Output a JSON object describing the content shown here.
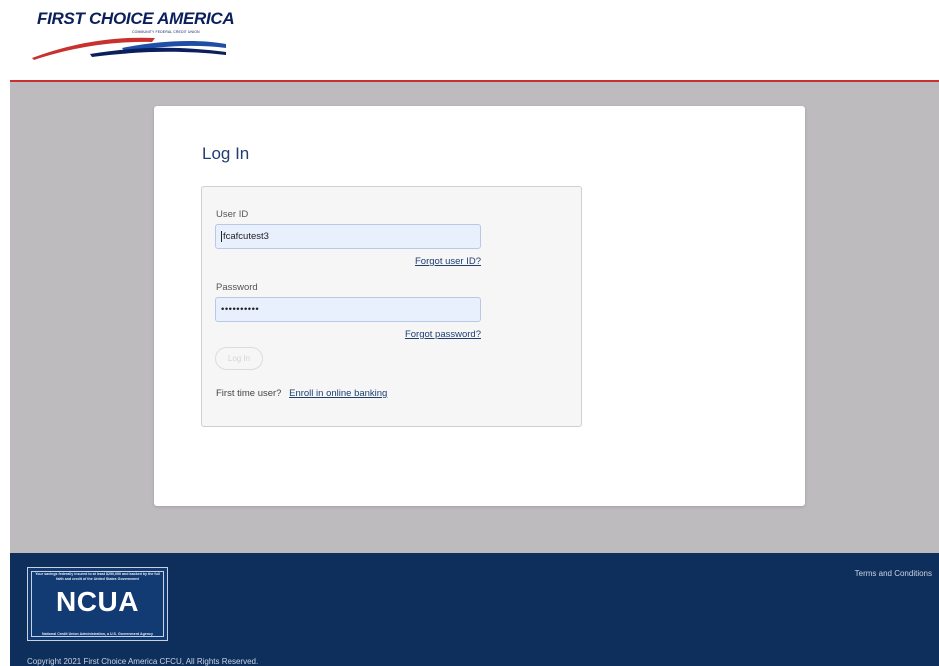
{
  "header": {
    "brand_name": "FIRST CHOICE AMERICA",
    "brand_tagline": "COMMUNITY FEDERAL CREDIT UNION",
    "accent_color": "#c8312d",
    "brand_color": "#0a1f5c"
  },
  "login": {
    "title": "Log In",
    "user_id_label": "User ID",
    "user_id_value": "fcafcutest3",
    "forgot_user_id": "Forgot user ID?",
    "password_label": "Password",
    "password_value": "••••••••••",
    "forgot_password": "Forgot password?",
    "login_button": "Log In",
    "first_time_text": "First time user?",
    "enroll_link": "Enroll in online banking"
  },
  "footer": {
    "ncua_top_text": "Your savings federally insured to at least $250,000 and backed by the full faith and credit of the United States Government",
    "ncua_word": "NCUA",
    "ncua_bottom_text": "National Credit Union Administration, a U.S. Government Agency",
    "terms_link": "Terms and Conditions",
    "copyright": "Copyright 2021 First Choice America CFCU, All Rights Reserved.",
    "background_color": "#0e2f5c"
  }
}
